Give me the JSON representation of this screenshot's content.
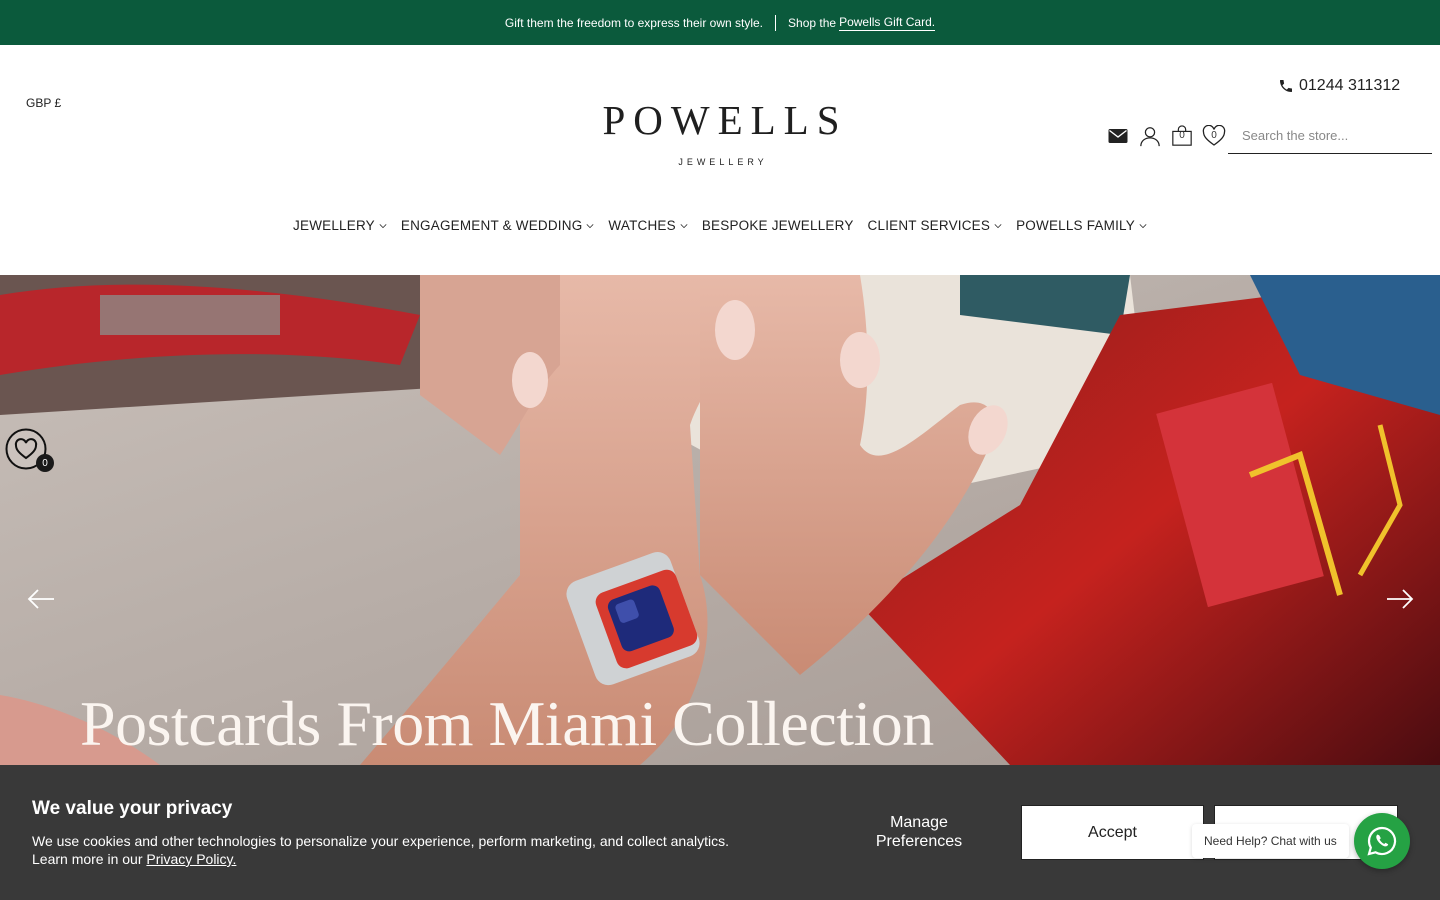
{
  "announcement": {
    "text": "Gift them the freedom to express their own style.",
    "shop_prefix": "Shop the",
    "link_text": "Powells Gift Card."
  },
  "header": {
    "currency": "GBP £",
    "logo_word": "POWELLS",
    "logo_sub": "JEWELLERY",
    "phone": "01244 311312",
    "cart_count": "0",
    "wishlist_count": "0",
    "search_placeholder": "Search the store..."
  },
  "nav": {
    "items": [
      {
        "label": "JEWELLERY",
        "has_dropdown": true
      },
      {
        "label": "ENGAGEMENT & WEDDING",
        "has_dropdown": true
      },
      {
        "label": "WATCHES",
        "has_dropdown": true
      },
      {
        "label": "BESPOKE JEWELLERY",
        "has_dropdown": false
      },
      {
        "label": "CLIENT SERVICES",
        "has_dropdown": true
      },
      {
        "label": "POWELLS FAMILY",
        "has_dropdown": true
      }
    ]
  },
  "hero": {
    "title": "Postcards From Miami Collection",
    "wishlist_count": "0"
  },
  "cookie": {
    "title": "We value your privacy",
    "body": "We use cookies and other technologies to personalize your experience, perform marketing, and collect analytics. Learn more in our",
    "policy_link": "Privacy Policy.",
    "manage_line1": "Manage",
    "manage_line2": "Preferences",
    "accept": "Accept"
  },
  "chat": {
    "label": "Need Help? Chat with us"
  },
  "colors": {
    "brand_green": "#0b5a3c",
    "banner_bg": "#393939",
    "whatsapp": "#25a244"
  }
}
